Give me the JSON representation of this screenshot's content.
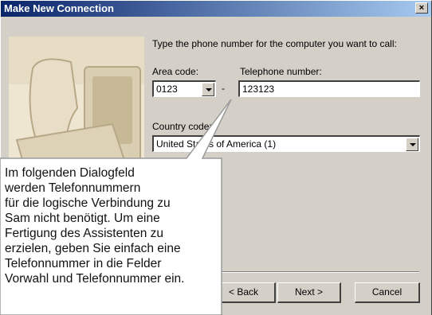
{
  "window": {
    "title": "Make New Connection",
    "close_glyph": "×"
  },
  "form": {
    "instruction": "Type the phone number for the computer you want to call:",
    "area_code_label": "Area code:",
    "area_code_value": "0123",
    "dash": "-",
    "telephone_label": "Telephone number:",
    "telephone_value": "123123",
    "country_label": "Country code:",
    "country_value": "United States of America (1)"
  },
  "buttons": {
    "back": "< Back",
    "next": "Next >",
    "cancel": "Cancel"
  },
  "callout": {
    "lines": [
      "Im folgenden Dialogfeld",
      "werden Telefonnummern",
      "für die logische Verbindung zu",
      "Sam nicht benötigt. Um eine",
      "Fertigung des Assistenten zu",
      "erzielen, geben Sie einfach eine",
      "Telefonnummer in die Felder",
      "Vorwahl und Telefonnummer ein."
    ]
  },
  "colors": {
    "title_gradient_start": "#0a246a",
    "title_gradient_end": "#a6caf0",
    "dialog_face": "#d4d0c8"
  }
}
